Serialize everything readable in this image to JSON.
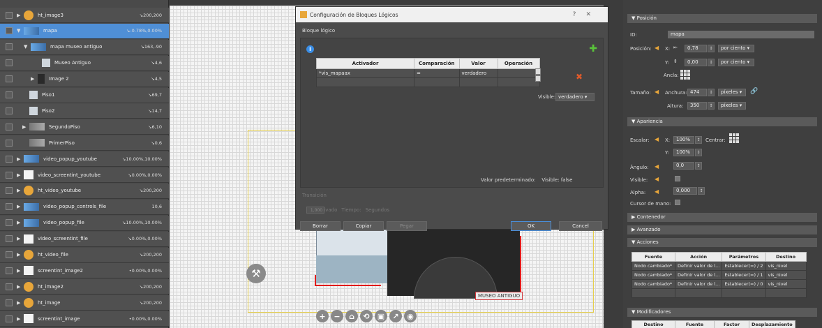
{
  "layers": [
    {
      "name": "ht_image3",
      "pos": "↘200,200",
      "thumb": "hot",
      "indent": 0,
      "expander": "▶",
      "selected": false
    },
    {
      "name": "mapa",
      "pos": "↘-0.78%,0.00%",
      "thumb": "img",
      "indent": 0,
      "expander": "▼",
      "selected": true
    },
    {
      "name": "mapa museo antiguo",
      "pos": "↘163,-90",
      "thumb": "img",
      "indent": 10,
      "expander": "▼",
      "selected": false
    },
    {
      "name": "Museo Antiguo",
      "pos": "↘4,6",
      "thumb": "txt",
      "indent": 26,
      "expander": "",
      "selected": false
    },
    {
      "name": "Image 2",
      "pos": "↘4,5",
      "thumb": "dark",
      "indent": 20,
      "expander": "▶",
      "selected": false
    },
    {
      "name": "Piso1",
      "pos": "↘69,7",
      "thumb": "txt",
      "indent": 8,
      "expander": "",
      "selected": false
    },
    {
      "name": "Piso2",
      "pos": "↘14,7",
      "thumb": "txt",
      "indent": 8,
      "expander": "",
      "selected": false
    },
    {
      "name": "SegundoPiso",
      "pos": "↘6,10",
      "thumb": "floor",
      "indent": 8,
      "expander": "▶",
      "selected": false
    },
    {
      "name": "PrimerPiso",
      "pos": "↘0,6",
      "thumb": "floor",
      "indent": 8,
      "expander": "",
      "selected": false
    },
    {
      "name": "video_popup_youtube",
      "pos": "↘10.00%,10.00%",
      "thumb": "img",
      "indent": 0,
      "expander": "▶",
      "selected": false
    },
    {
      "name": "video_screentint_youtube",
      "pos": "↘0.00%,0.00%",
      "thumb": "white",
      "indent": 0,
      "expander": "▶",
      "selected": false
    },
    {
      "name": "ht_video_youtube",
      "pos": "↘200,200",
      "thumb": "hot",
      "indent": 0,
      "expander": "▶",
      "selected": false
    },
    {
      "name": "video_popup_controls_file",
      "pos": "10,6",
      "thumb": "img",
      "indent": 0,
      "expander": "▶",
      "selected": false
    },
    {
      "name": "video_popup_file",
      "pos": "↘10.00%,10.00%",
      "thumb": "img",
      "indent": 0,
      "expander": "▶",
      "selected": false
    },
    {
      "name": "video_screentint_file",
      "pos": "↘0.00%,0.00%",
      "thumb": "white",
      "indent": 0,
      "expander": "▶",
      "selected": false
    },
    {
      "name": "ht_video_file",
      "pos": "↘200,200",
      "thumb": "hot",
      "indent": 0,
      "expander": "▶",
      "selected": false
    },
    {
      "name": "screentint_image2",
      "pos": "•0.00%,0.00%",
      "thumb": "white",
      "indent": 0,
      "expander": "▶",
      "selected": false
    },
    {
      "name": "ht_image2",
      "pos": "↘200,200",
      "thumb": "hot",
      "indent": 0,
      "expander": "▶",
      "selected": false
    },
    {
      "name": "ht_image",
      "pos": "↘200,200",
      "thumb": "hot",
      "indent": 0,
      "expander": "▶",
      "selected": false
    },
    {
      "name": "screentint_image",
      "pos": "•0.00%,0.00%",
      "thumb": "white",
      "indent": 0,
      "expander": "▶",
      "selected": false
    }
  ],
  "canvas": {
    "map_label": "MUSEO ANTIGUO",
    "toolbar": [
      "+",
      "−",
      "⌂",
      "⟲",
      "▣",
      "↗",
      "◉"
    ]
  },
  "dialog": {
    "title": "Configuración de Bloques Lógicos",
    "section": "Bloque lógico",
    "columns": [
      "Activador",
      "Comparación",
      "Valor",
      "Operación"
    ],
    "rows": [
      {
        "activador": "*vis_mapaax",
        "comparacion": "=",
        "valor": "verdadero",
        "operacion": ""
      },
      {
        "activador": "",
        "comparacion": "",
        "valor": "",
        "operacion": ""
      }
    ],
    "visible_label": "Visible:",
    "visible_value": "verdadero",
    "default_label": "Valor predeterminado:",
    "default_visible": "Visible:  false",
    "transition_label": "Transición",
    "transition_active": "Activado",
    "transition_time_label": "Tiempo:",
    "transition_time_value": "1,000",
    "transition_unit": "Segundos",
    "buttons": {
      "delete": "Borrar",
      "copy": "Copiar",
      "paste": "Pegar",
      "ok": "OK",
      "cancel": "Cancel"
    }
  },
  "props": {
    "posicion": {
      "header": "Posición",
      "id_label": "ID:",
      "id_value": "mapa",
      "pos_label": "Posición:",
      "x_label": "X:",
      "x_value": "0,78",
      "x_unit": "por ciento",
      "y_label": "Y:",
      "y_value": "0,00",
      "y_unit": "por ciento",
      "anchor_label": "Ancla:",
      "size_label": "Tamaño:",
      "w_label": "Anchura:",
      "w_value": "474",
      "w_unit": "píxeles",
      "h_label": "Altura:",
      "h_value": "350",
      "h_unit": "píxeles"
    },
    "apariencia": {
      "header": "Apariencia",
      "scale_label": "Escalar:",
      "sx_label": "X:",
      "sx_value": "100%",
      "center_label": "Centrar:",
      "sy_label": "Y:",
      "sy_value": "100%",
      "angle_label": "Ángulo:",
      "angle_value": "0,0",
      "visible_label": "Visible:",
      "alpha_label": "Alpha:",
      "alpha_value": "0,000",
      "cursor_label": "Cursor de mano:"
    },
    "contenedor": "Contenedor",
    "avanzado": "Avanzado",
    "acciones": {
      "header": "Acciones",
      "columns": [
        "Fuente",
        "Acción",
        "Parámetros",
        "Destino"
      ],
      "rows": [
        [
          "Nodo cambiado*",
          "Definir valor de l...",
          "Establecer(=) / 2",
          "vis_nivel"
        ],
        [
          "Nodo cambiado*",
          "Definir valor de l...",
          "Establecer(=) / 1",
          "vis_nivel"
        ],
        [
          "Nodo cambiado*",
          "Definir valor de l...",
          "Establecer(=) / 0",
          "vis_nivel"
        ],
        [
          "",
          "",
          "",
          ""
        ]
      ]
    },
    "modificadores": {
      "header": "Modificadores",
      "columns": [
        "Destino",
        "Fuente",
        "Factor",
        "Desplazamiento"
      ]
    }
  },
  "colors": {
    "selection": "#4f8fd6",
    "accent_orange": "#e8a63a",
    "add_green": "#59c23a",
    "delete_red": "#e05a2a",
    "info_blue": "#3a8ee6"
  }
}
